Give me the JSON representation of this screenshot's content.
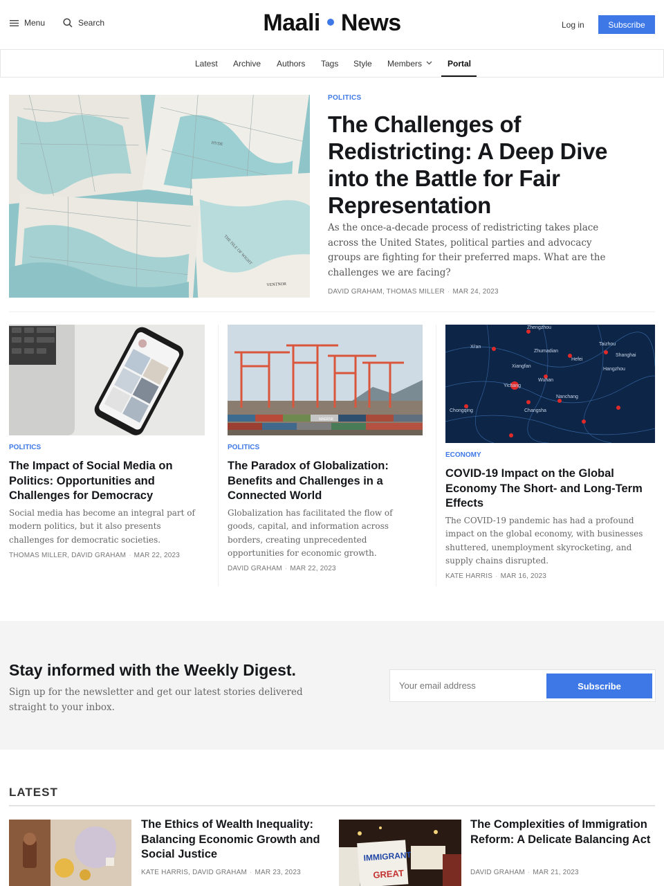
{
  "header": {
    "menu_label": "Menu",
    "search_label": "Search",
    "logo_left": "Maali",
    "logo_right": "News",
    "login_label": "Log in",
    "subscribe_label": "Subscribe"
  },
  "nav": {
    "items": [
      "Latest",
      "Archive",
      "Authors",
      "Tags",
      "Style",
      "Members",
      "Portal"
    ],
    "active": "Portal"
  },
  "featured": {
    "category": "POLITICS",
    "title": "The Challenges of Redistricting: A Deep Dive into the Battle for Fair Representation",
    "excerpt": "As the once-a-decade process of redistricting takes place across the United States, political parties and advocacy groups are fighting for their preferred maps. What are the challenges we are facing?",
    "authors": "DAVID GRAHAM, THOMAS MILLER",
    "date": "MAR 24, 2023"
  },
  "cards": [
    {
      "category": "POLITICS",
      "title": "The Impact of Social Media on Politics: Opportunities and Challenges for Democracy",
      "excerpt": "Social media has become an integral part of modern politics, but it also presents challenges for democratic societies.",
      "authors": "THOMAS MILLER, DAVID GRAHAM",
      "date": "MAR 22, 2023"
    },
    {
      "category": "POLITICS",
      "title": "The Paradox of Globalization: Benefits and Challenges in a Connected World",
      "excerpt": "Globalization has facilitated the flow of goods, capital, and information across borders, creating unprecedented opportunities for economic growth.",
      "authors": "DAVID GRAHAM",
      "date": "MAR 22, 2023"
    },
    {
      "category": "ECONOMY",
      "title": "COVID-19 Impact on the Global Economy The Short- and Long-Term Effects",
      "excerpt": "The COVID-19 pandemic has had a profound impact on the global economy, with businesses shuttered, unemployment skyrocketing, and supply chains disrupted.",
      "authors": "KATE HARRIS",
      "date": "MAR 16, 2023"
    }
  ],
  "map_labels": {
    "feature": [
      "HYDE",
      "THE ISLE OF WIGHT",
      "VENTNOR"
    ],
    "china": [
      "Zhengzhou",
      "Xi'an",
      "Zhumadian",
      "Taizhou",
      "Shanghai",
      "Hefei",
      "Xiangfan",
      "Hangzhou",
      "Wuhan",
      "Yichang",
      "Chongqing",
      "Changsha",
      "Nanchang"
    ]
  },
  "container_text": "MAERSK",
  "sign_text": [
    "IMMIGRANTS",
    "GREAT"
  ],
  "newsletter": {
    "title": "Stay informed with the Weekly Digest.",
    "description": "Sign up for the newsletter and get our latest stories delivered straight to your inbox.",
    "email_placeholder": "Your email address",
    "button_label": "Subscribe"
  },
  "latest": {
    "heading": "LATEST",
    "items": [
      {
        "title": "The Ethics of Wealth Inequality: Balancing Economic Growth and Social Justice",
        "authors": "KATE HARRIS, DAVID GRAHAM",
        "date": "MAR 23, 2023"
      },
      {
        "title": "The Complexities of Immigration Reform: A Delicate Balancing Act",
        "authors": "DAVID GRAHAM",
        "date": "MAR 21, 2023"
      }
    ]
  },
  "colors": {
    "accent": "#3d78e6",
    "text": "#15171a",
    "muted": "#777777",
    "newsletter_bg": "#f4f4f4"
  }
}
